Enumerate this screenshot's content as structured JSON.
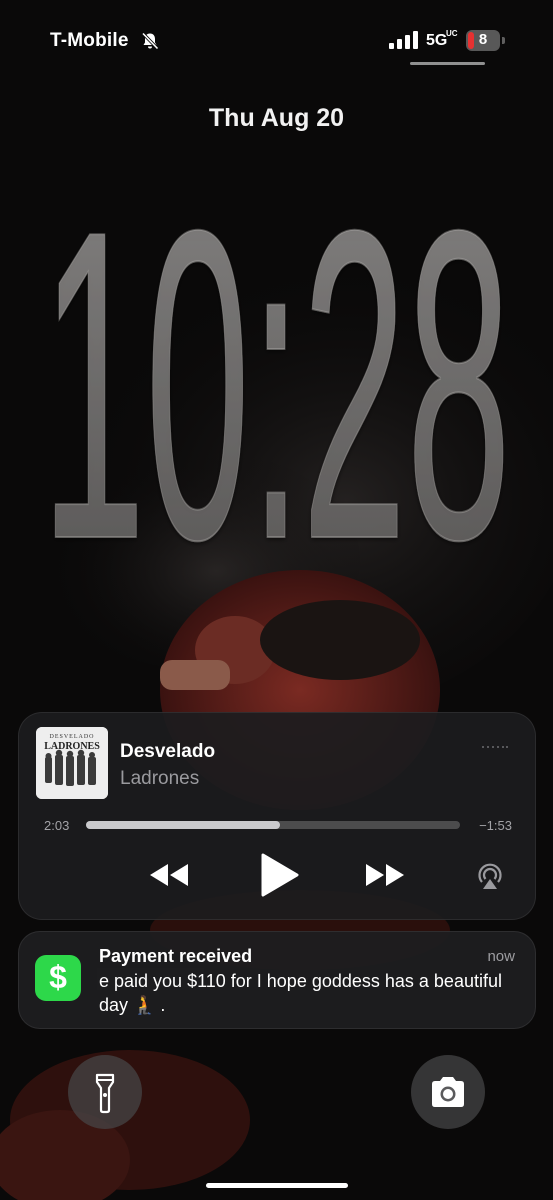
{
  "status_bar": {
    "carrier": "T-Mobile",
    "mute_icon": "bell-slash-icon",
    "signal_bars": 4,
    "network": "5G",
    "network_superscript": "UC",
    "battery_level": "8",
    "battery_color": "#e63131"
  },
  "lock_screen": {
    "date": "Thu Aug 20",
    "time": "10:28"
  },
  "media_player": {
    "album_art_title": "DESVELADO",
    "album_art_band": "LADRONES",
    "title": "Desvelado",
    "artist": "Ladrones",
    "elapsed": "2:03",
    "remaining": "−1:53",
    "progress_fraction": 0.52,
    "rewind_icon": "backward-icon",
    "play_icon": "play-icon",
    "forward_icon": "forward-icon",
    "airplay_icon": "airplay-icon"
  },
  "notification": {
    "app_icon": "cash-app-icon",
    "app_glyph": "$",
    "app_color": "#2dd84a",
    "title": "Payment received",
    "time": "now",
    "body": "e paid you $110 for I hope goddess has a beautiful day 🧎 .",
    "body_emoji": "🧎"
  },
  "quick_actions": {
    "flashlight_icon": "flashlight-icon",
    "camera_icon": "camera-icon"
  }
}
